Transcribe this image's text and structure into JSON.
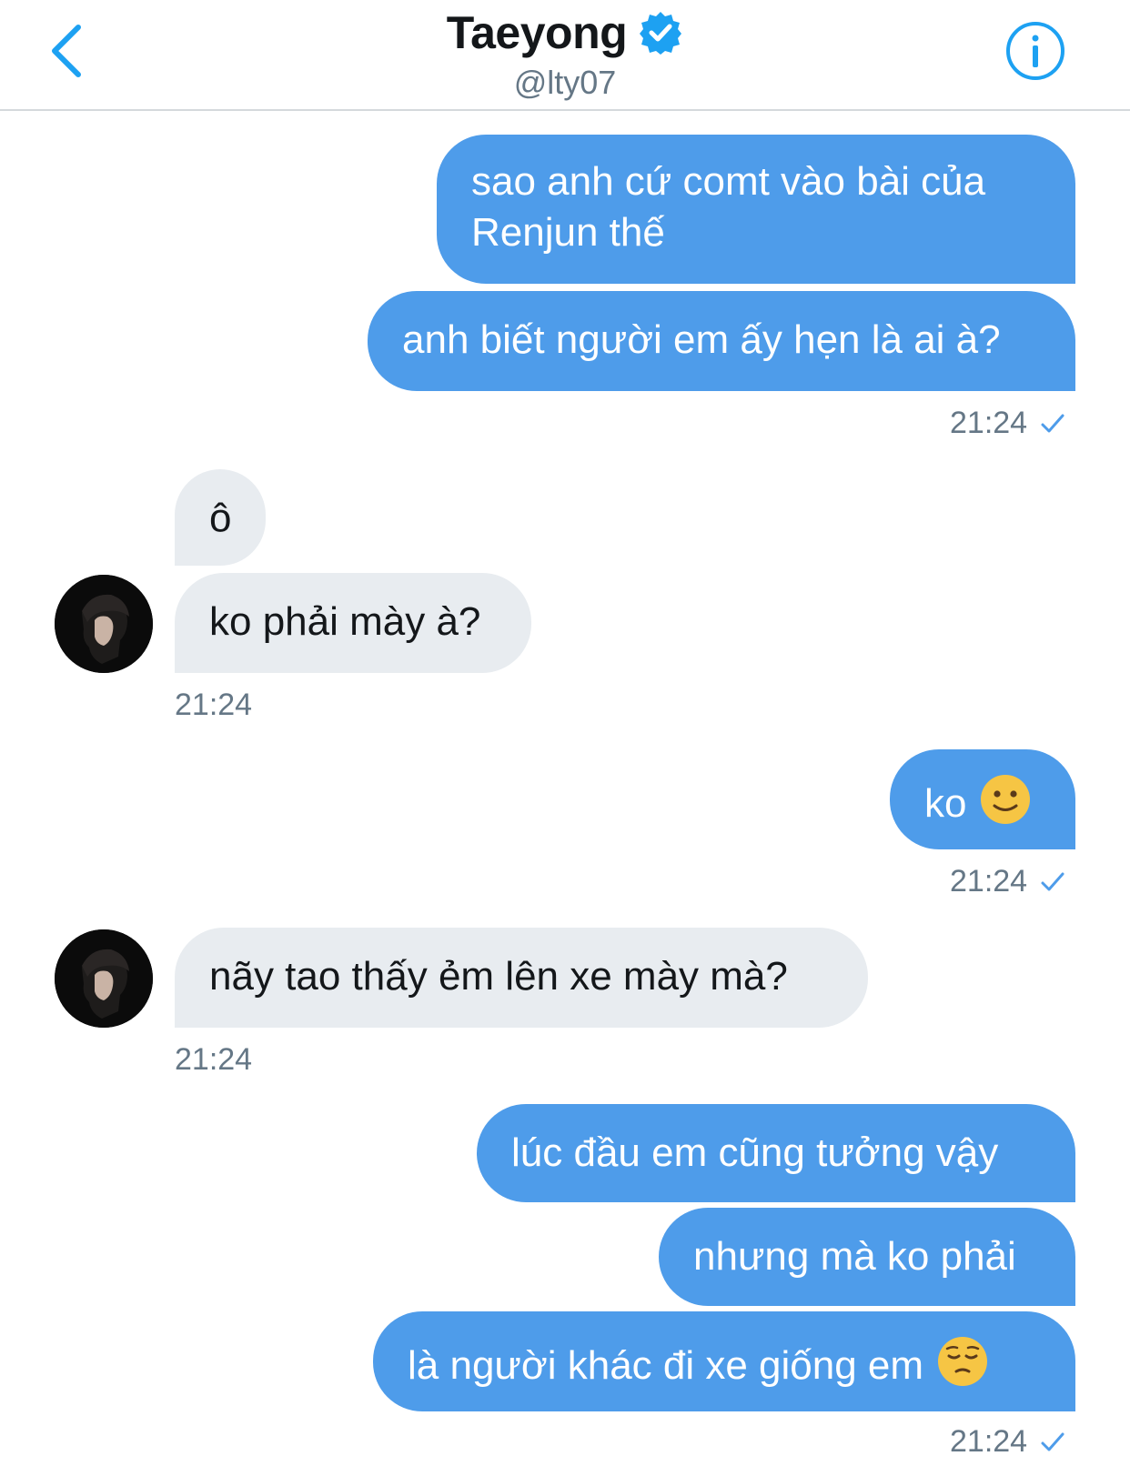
{
  "header": {
    "name": "Taeyong",
    "handle": "@lty07"
  },
  "messages": [
    {
      "id": "m1",
      "side": "out",
      "text": "sao anh cứ comt vào bài của Renjun thế"
    },
    {
      "id": "m2",
      "side": "out",
      "text": "anh biết người em ấy hẹn là ai à?"
    },
    {
      "id": "m3",
      "side": "in",
      "text": "ô"
    },
    {
      "id": "m4",
      "side": "in",
      "text": "ko phải mày à?"
    },
    {
      "id": "m5",
      "side": "out",
      "text": "ko",
      "emoji": "slightly-smiling-face"
    },
    {
      "id": "m6",
      "side": "in",
      "text": "nãy tao thấy ẻm lên xe mày mà?"
    },
    {
      "id": "m7",
      "side": "out",
      "text": "lúc đầu em cũng tưởng vậy"
    },
    {
      "id": "m8",
      "side": "out",
      "text": "nhưng mà ko phải"
    },
    {
      "id": "m9",
      "side": "out",
      "text": "là người khác đi xe giống em",
      "emoji": "pensive-face"
    }
  ],
  "timestamps": {
    "t1": "21:24",
    "t2": "21:24",
    "t3": "21:24",
    "t4": "21:24",
    "t5": "21:24",
    "t6": "21:24"
  },
  "colors": {
    "accent": "#1da1f2",
    "outgoing_bubble": "#4e9cea",
    "incoming_bubble": "#e8ecf0",
    "timestamp": "#657786"
  },
  "icons": {
    "back": "chevron-left-icon",
    "info": "info-icon",
    "verified": "verified-badge-icon",
    "read": "check-icon"
  }
}
